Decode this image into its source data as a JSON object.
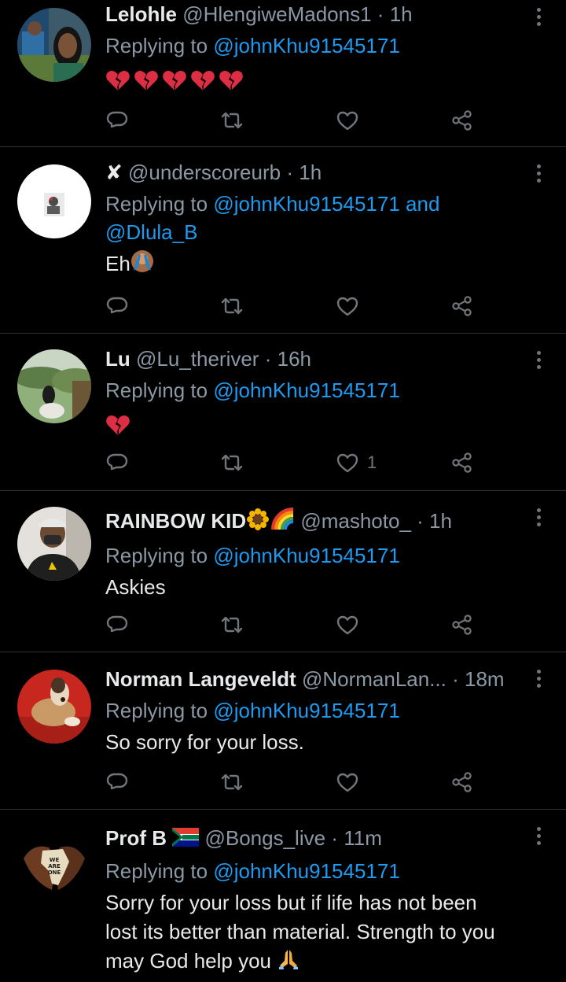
{
  "replying_prefix": "Replying to",
  "tweets": [
    {
      "name": "Lelohle",
      "handle": "@HlengiweMadons1",
      "sep": "·",
      "time": "1h",
      "replying_to": "@johnKhu91545171",
      "replying_extra": "",
      "body": "",
      "like_count": ""
    },
    {
      "name": "✘",
      "handle": "@underscoreurb",
      "sep": "·",
      "time": "1h",
      "replying_to": "@johnKhu91545171 and",
      "replying_extra": "@Dlula_B",
      "body": "Eh",
      "like_count": ""
    },
    {
      "name": "Lu",
      "handle": "@Lu_theriver",
      "sep": "·",
      "time": "16h",
      "replying_to": "@johnKhu91545171",
      "replying_extra": "",
      "body": "",
      "like_count": "1"
    },
    {
      "name": "RAINBOW KID",
      "handle": "@mashoto_",
      "sep": "·",
      "time": "1h",
      "replying_to": "@johnKhu91545171",
      "replying_extra": "",
      "body": "Askies",
      "like_count": ""
    },
    {
      "name": "Norman Langeveldt",
      "handle": "@NormanLan...",
      "sep": "·",
      "time": "18m",
      "replying_to": "@johnKhu91545171",
      "replying_extra": "",
      "body": "So sorry for your loss.",
      "like_count": ""
    },
    {
      "name": "Prof B",
      "handle": "@Bongs_live",
      "sep": "·",
      "time": "11m",
      "replying_to": "@johnKhu91545171",
      "replying_extra": "",
      "body_lines": [
        "Sorry for your loss but if life has not been",
        "lost its better than material. Strength to you",
        "may God help you"
      ],
      "like_count": ""
    }
  ],
  "avatar_text": {
    "prof_b": [
      "WE",
      "ARE",
      "ONE"
    ]
  },
  "colors": {
    "background": "#000000",
    "divider": "#2f3336",
    "text": "#e7e9ea",
    "muted": "#8b98a5",
    "mention": "#1d9bf0",
    "icon": "#71767b"
  },
  "icons": [
    "reply-icon",
    "retweet-icon",
    "like-icon",
    "share-icon",
    "more-options-icon",
    "broken-heart-emoji",
    "person-gesturing-no-emoji",
    "sunflower-emoji",
    "rainbow-emoji",
    "south-africa-flag-emoji",
    "folded-hands-emoji"
  ]
}
